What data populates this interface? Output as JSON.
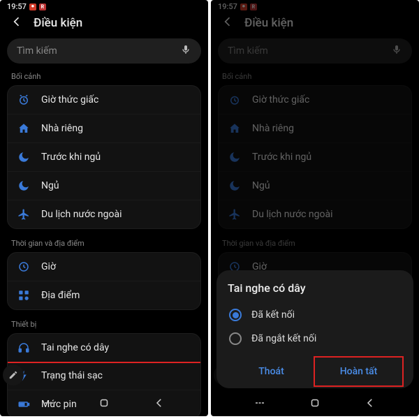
{
  "status": {
    "time": "19:57",
    "badge": "R"
  },
  "header": {
    "title": "Điều kiện"
  },
  "search": {
    "placeholder": "Tìm kiếm"
  },
  "sections": {
    "context": {
      "label": "Bối cảnh",
      "items": [
        "Giờ thức giấc",
        "Nhà riêng",
        "Trước khi ngủ",
        "Ngủ",
        "Du lịch nước ngoài"
      ]
    },
    "timeplace": {
      "label": "Thời gian và địa điểm",
      "items": [
        "Giờ",
        "Địa điểm"
      ]
    },
    "device": {
      "label": "Thiết bị",
      "items": [
        "Tai nghe có dây",
        "Trạng thái sạc",
        "Mức pin"
      ]
    }
  },
  "sheet": {
    "title": "Tai nghe có dây",
    "opt_connected": "Đã kết nối",
    "opt_disconnected": "Đã ngắt kết nối",
    "cancel": "Thoát",
    "done": "Hoàn tất"
  }
}
